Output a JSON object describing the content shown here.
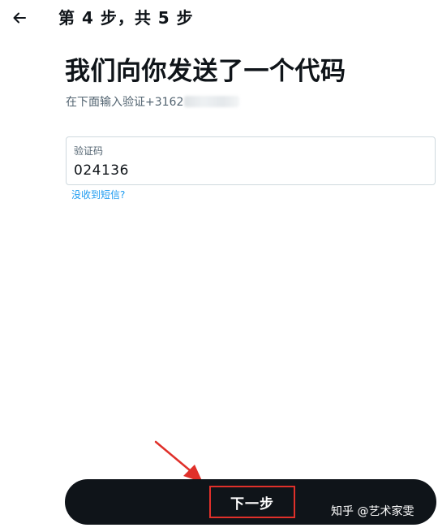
{
  "header": {
    "back_icon": "arrow-left-icon",
    "step_title": "第 4 步，共 5 步"
  },
  "main": {
    "heading": "我们向你发送了一个代码",
    "subtext": "在下面输入验证+3162"
  },
  "code_input": {
    "label": "验证码",
    "value": "024136"
  },
  "resend_link": "没收到短信?",
  "footer": {
    "next_label": "下一步"
  },
  "watermark": "知乎 @艺术家雯",
  "colors": {
    "text": "#0f1419",
    "secondary_text": "#536471",
    "link": "#1d9bf0",
    "border": "#cfd9de",
    "bar_background": "#0f1419",
    "annotation_red": "#e0302a"
  }
}
